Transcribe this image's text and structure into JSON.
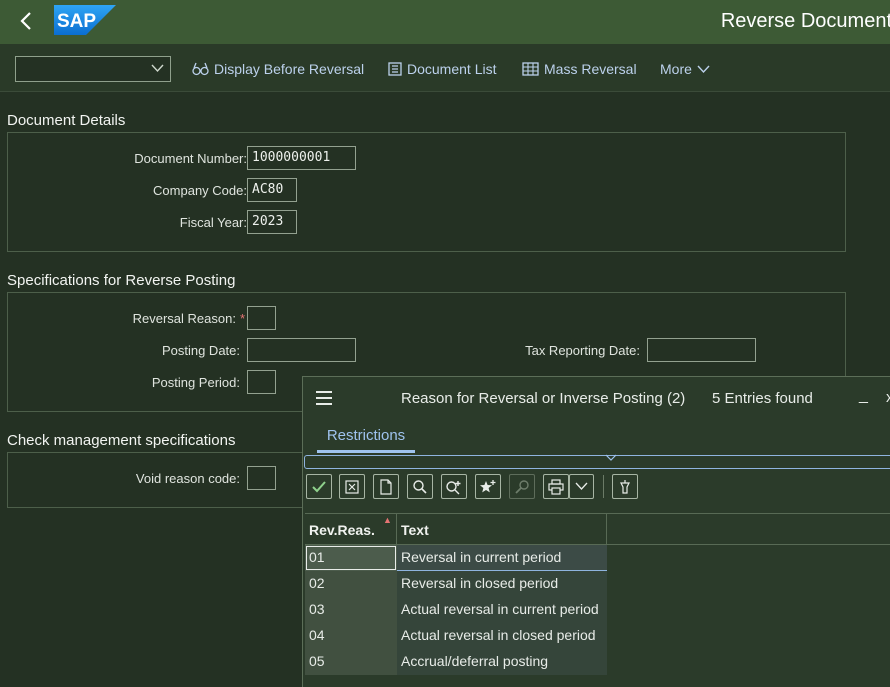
{
  "shell": {
    "title": "Reverse Document",
    "logo": "SAP"
  },
  "toolbar": {
    "command_value": "",
    "display_before_reversal": "Display Before Reversal",
    "document_list": "Document List",
    "mass_reversal": "Mass Reversal",
    "more": "More"
  },
  "document_details": {
    "title": "Document Details",
    "document_number_label": "Document Number:",
    "document_number": "1000000001",
    "company_code_label": "Company Code:",
    "company_code": "AC80",
    "fiscal_year_label": "Fiscal Year:",
    "fiscal_year": "2023"
  },
  "reverse_posting": {
    "title": "Specifications for Reverse Posting",
    "reversal_reason_label": "Reversal Reason:",
    "required_mark": "*",
    "reversal_reason": "",
    "posting_date_label": "Posting Date:",
    "posting_date": "",
    "tax_reporting_date_label": "Tax Reporting Date:",
    "tax_reporting_date": "",
    "posting_period_label": "Posting Period:",
    "posting_period": ""
  },
  "check_management": {
    "title": "Check management specifications",
    "void_reason_label": "Void reason code:",
    "void_reason": ""
  },
  "popup": {
    "title": "Reason for Reversal or Inverse Posting (2)",
    "entries_found": "5 Entries found",
    "minimize": "_",
    "close": "x",
    "tab_restrictions": "Restrictions",
    "columns": {
      "code": "Rev.Reas.",
      "text": "Text"
    },
    "rows": [
      {
        "code": "01",
        "text": "Reversal in current period"
      },
      {
        "code": "02",
        "text": "Reversal in closed period"
      },
      {
        "code": "03",
        "text": "Actual reversal in current period"
      },
      {
        "code": "04",
        "text": "Actual reversal in closed period"
      },
      {
        "code": "05",
        "text": "Accrual/deferral posting"
      }
    ]
  },
  "colors": {
    "shell": "#3d5a35",
    "background": "#243123",
    "link": "#bcd1ec",
    "accent": "#9fc3ee",
    "required": "#e57373"
  }
}
